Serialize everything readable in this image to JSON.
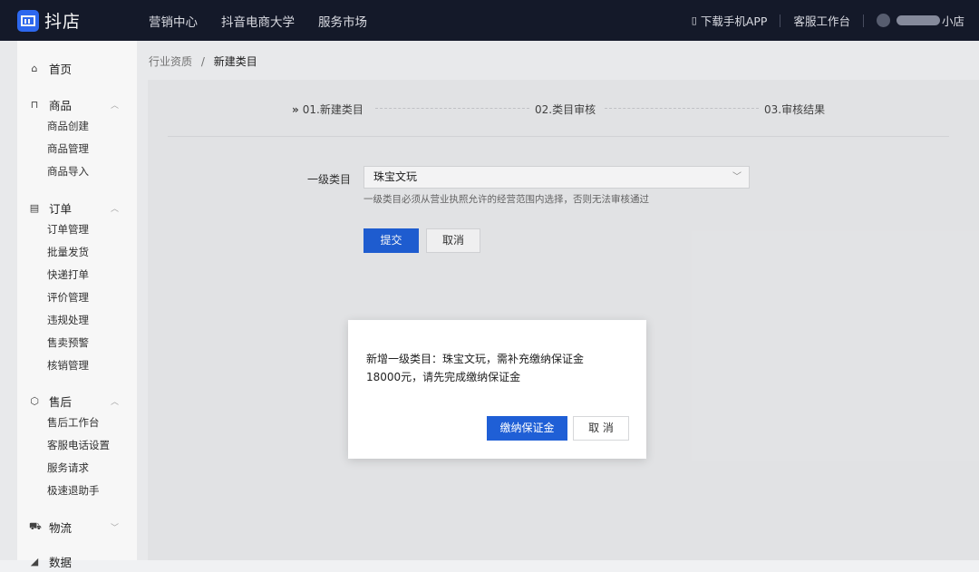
{
  "app": {
    "name": "抖店"
  },
  "topnav": [
    "营销中心",
    "抖音电商大学",
    "服务市场"
  ],
  "topright": {
    "download": "下载手机APP",
    "service": "客服工作台",
    "shop_suffix": "小店"
  },
  "sidebar": {
    "home": "首页",
    "groups": [
      {
        "label": "商品",
        "items": [
          "商品创建",
          "商品管理",
          "商品导入"
        ]
      },
      {
        "label": "订单",
        "items": [
          "订单管理",
          "批量发货",
          "快递打单",
          "评价管理",
          "违规处理",
          "售卖预警",
          "核销管理"
        ]
      },
      {
        "label": "售后",
        "items": [
          "售后工作台",
          "客服电话设置",
          "服务请求",
          "极速退助手"
        ]
      },
      {
        "label": "物流",
        "items": []
      },
      {
        "label": "数据",
        "items": []
      }
    ]
  },
  "breadcrumb": {
    "parent": "行业资质",
    "sep": "/",
    "current": "新建类目"
  },
  "steps": {
    "prefix": "»",
    "s1": "01.新建类目",
    "s2": "02.类目审核",
    "s3": "03.审核结果"
  },
  "form": {
    "label": "一级类目",
    "value": "珠宝文玩",
    "hint": "一级类目必须从营业执照允许的经营范围内选择，否则无法审核通过",
    "submit": "提交",
    "cancel": "取消"
  },
  "modal": {
    "line1": "新增一级类目：珠宝文玩，需补充缴纳保证金",
    "line2": "18000元，请先完成缴纳保证金",
    "confirm": "缴纳保证金",
    "cancel": "取 消"
  },
  "colors": {
    "topbar": "#151a2b",
    "primary": "#1f5fd6",
    "logo": "#2f6cf6"
  }
}
